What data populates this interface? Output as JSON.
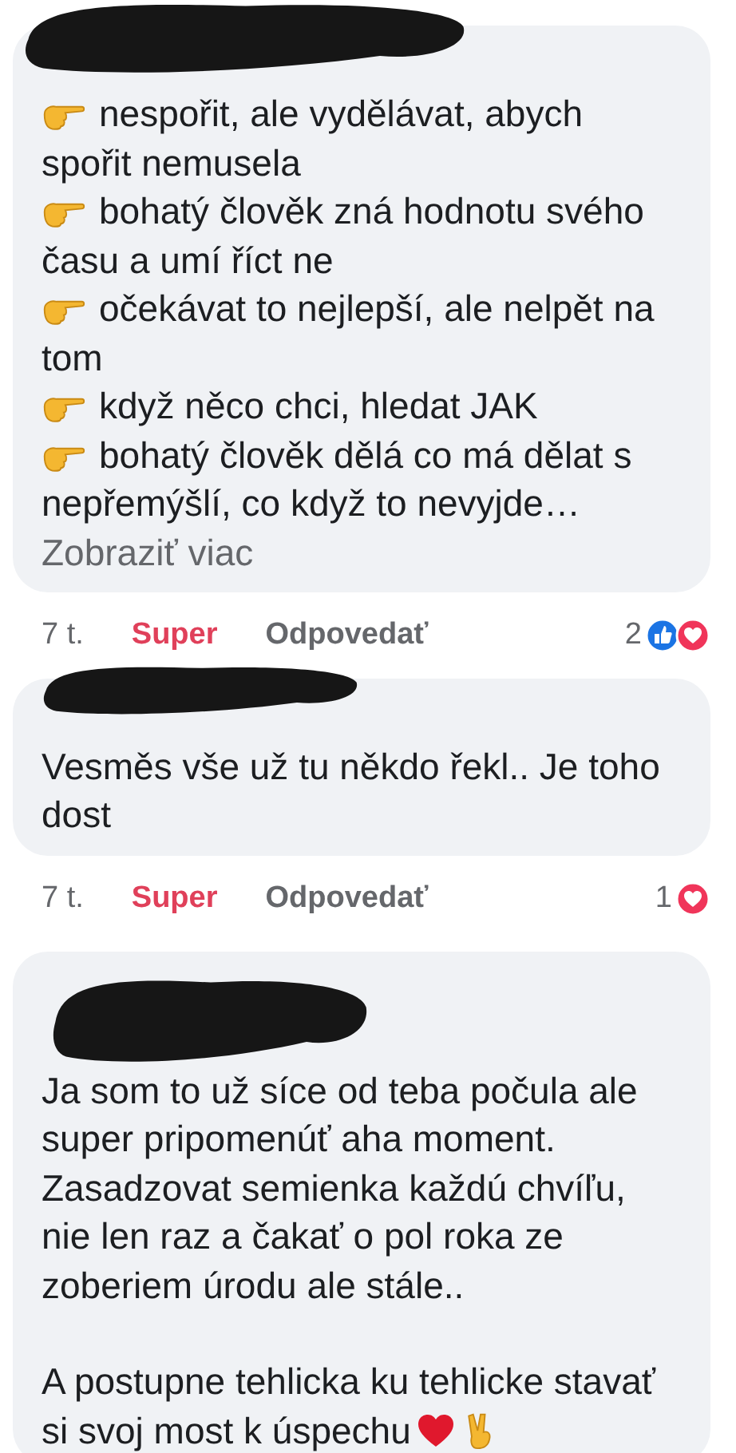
{
  "comments": [
    {
      "kind": "bullets",
      "bullets": [
        "nespořit, ale vydělávat, abych spořit nemusela",
        "bohatý člověk zná hodnotu svého času a umí říct ne",
        "očekávat to nejlepší, ale nelpět na tom",
        "když něco chci, hledat JAK",
        "bohatý člověk dělá co má dělat s nepřemýšlí, co když to nevyjde…"
      ],
      "more": "Zobraziť viac",
      "time": "7 t.",
      "reaction_label": "Super",
      "reply": "Odpovedať",
      "count": "2",
      "reactions": [
        {
          "kind": "like"
        },
        {
          "kind": "love"
        }
      ]
    },
    {
      "kind": "text",
      "paragraphs": [
        "Vesměs vše už tu někdo řekl.. Je toho dost"
      ],
      "time": "7 t.",
      "reaction_label": "Super",
      "reply": "Odpovedať",
      "count": "1",
      "reactions": [
        {
          "kind": "love"
        }
      ]
    },
    {
      "kind": "text",
      "paragraphs": [
        "Ja som to už síce od teba počula ale super pripomenúť aha moment. Zasadzovat semienka každú chvíľu, nie len raz a čakať o  pol roka ze zoberiem úrodu ale stále..",
        "A postupne tehlicka ku tehlicke stavať si svoj most k úspechu"
      ],
      "trailing_emoji": [
        {
          "kind": "heart"
        },
        {
          "kind": "victory"
        }
      ]
    }
  ]
}
